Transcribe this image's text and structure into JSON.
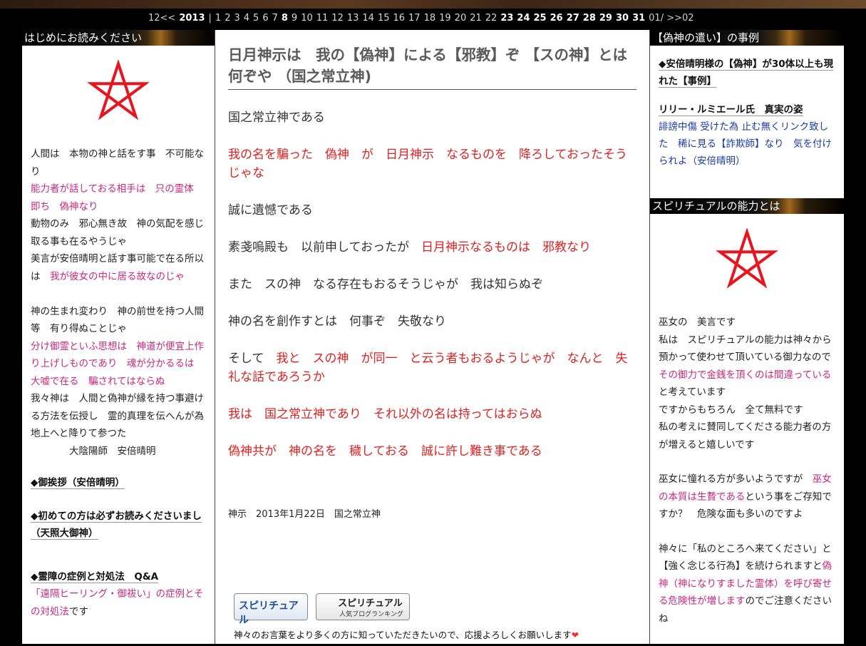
{
  "calendar": {
    "prev": "12<<",
    "year": "2013",
    "sep": "|",
    "days": [
      "1",
      "2",
      "3",
      "4",
      "5",
      "6",
      "7",
      "8",
      "9",
      "10",
      "11",
      "12",
      "13",
      "14",
      "15",
      "16",
      "17",
      "18",
      "19",
      "20",
      "21",
      "22",
      "23",
      "24",
      "25",
      "26",
      "27",
      "28",
      "29",
      "30",
      "31"
    ],
    "bold_days": [
      "8",
      "23",
      "24",
      "25",
      "26",
      "27",
      "28",
      "29",
      "30",
      "31"
    ],
    "next": "01/ >>02"
  },
  "left": {
    "header": "はじめにお読みください",
    "lines": [
      {
        "text": "人間は　本物の神と話をす事　不可能なり",
        "color": "normal"
      },
      {
        "text": "能力者が話しておる相手は　只の霊体　即ち　偽神なり",
        "color": "pink"
      },
      {
        "text": "動物のみ　邪心無き故　神の気配を感じ取る事も在るやうじゃ",
        "color": "normal"
      },
      {
        "text": "美言が安倍晴明と話す事可能で在る所以は",
        "color": "normal",
        "tail": "　我が彼女の中に居る故なのじゃ"
      },
      {
        "text": "",
        "color": "normal"
      },
      {
        "text": "神の生まれ変わり　神の前世を持つ人間　等　有り得ぬことじゃ",
        "color": "normal"
      },
      {
        "text": "分け御霊といふ思想は　神道が便宜上作り上げしものであり　魂が分かるるは　大嘘で在る　騙されてはならぬ",
        "color": "pink"
      },
      {
        "text": "我々神は　人間と偽神が縁を持つ事避ける方法を伝授し　霊的真理を伝へんが為　地上へと降りて参つた",
        "color": "normal"
      },
      {
        "text": "　　　　大陰陽師　安倍晴明",
        "color": "normal"
      }
    ],
    "links": [
      "◆御挨拶（安倍晴明）",
      "◆初めての方は必ずお読みくださいまし（天照大御神）",
      "◆霊障の症例と対処法　Q&A"
    ],
    "tail_pink": "「遠隔ヒーリング・御祓い」の症例とその対処法",
    "tail_normal": "です"
  },
  "post": {
    "title": "日月神示は　我の【偽神】による【邪教】ぞ 【スの神】とは何ぞや （国之常立神)",
    "paragraphs": [
      [
        {
          "t": "国之常立神である",
          "c": "n"
        }
      ],
      [
        {
          "t": "我の名を騙った　偽神　が　日月神示　なるものを　降ろしておったそうじゃな",
          "c": "r"
        }
      ],
      [
        {
          "t": "誠に遺憾である",
          "c": "n"
        }
      ],
      [
        {
          "t": "素戔嗚殿も　以前申しておったが　",
          "c": "n"
        },
        {
          "t": "日月神示なるものは　邪教なり",
          "c": "r"
        }
      ],
      [
        {
          "t": "また　スの神　なる存在もおるそうじゃが　我は知らぬぞ",
          "c": "n"
        }
      ],
      [
        {
          "t": "神の名を創作すとは　何事ぞ　失敬なり",
          "c": "n"
        }
      ],
      [
        {
          "t": "そして　",
          "c": "n"
        },
        {
          "t": "我と　スの神　が同一　と云う者もおるようじゃが　なんと　失礼な話であろうか",
          "c": "r"
        }
      ],
      [
        {
          "t": "我は　国之常立神であり　それ以外の名は持ってはおらぬ",
          "c": "r"
        }
      ],
      [
        {
          "t": "偽神共が　神の名を　穢しておる　誠に許し難き事である",
          "c": "r"
        }
      ]
    ],
    "meta": "神示　2013年1月22日　国之常立神",
    "banner1": "スピリチュアル",
    "banner2": "スピリチュアル",
    "banner2_sub": "人気ブログランキング",
    "support": "神々のお言葉をより多くの方に知っていただきたいので、応援よろしくお願いします"
  },
  "right": {
    "header1": "【偽神の遣い】の事例",
    "link1": "◆安倍晴明様の【偽神】が30体以上も現れた【事例】",
    "link2": "リリー・ルミエール氏　真実の姿",
    "blue_text": "誹謗中傷 受けた為 止む無くリンク致した　稀に見る【詐欺師】なり　気を付けられよ（安倍晴明）",
    "header2": "スピリチュアルの能力とは",
    "para1_a": "巫女の　美言です",
    "para1_b": "私は　スピリチュアルの能力は神々から預かって使わせて頂いている御力なので",
    "para1_pink": "その御力で金銭を頂くのは間違っている",
    "para1_c": "と考えています",
    "para2": "ですからもちろん　全て無料です",
    "para3": "私の考えに賛同してくださる能力者の方が増えると嬉しいです",
    "para4_a": "巫女に憧れる方が多いようですが　",
    "para4_pink": "巫女の本質は生贄である",
    "para4_b": "という事をご存知ですか？　危険な面も多いのですよ",
    "para5_a": "神々に「私のところへ来てください」と【強く念じる行為】を続けられますと",
    "para5_pink": "偽神（神になりすました霊体）を呼び寄せる危険性が増します",
    "para5_b": "のでご注意くださいね"
  }
}
